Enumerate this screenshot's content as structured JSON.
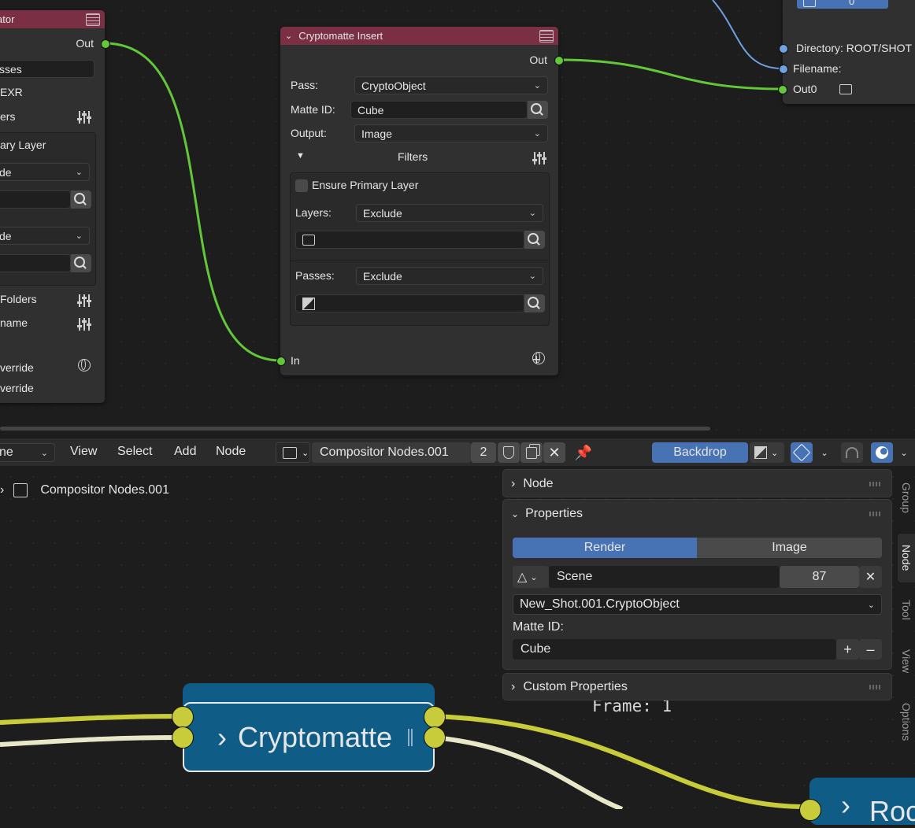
{
  "left_node": {
    "title": "ator",
    "out_label": "Out",
    "field_value": "sses",
    "format": "EXR",
    "rows": [
      "ers",
      "ary Layer",
      "de",
      "de",
      "Folders",
      "name",
      "verride",
      "verride"
    ]
  },
  "crypto_node": {
    "title": "Cryptomatte Insert",
    "out_label": "Out",
    "pass_label": "Pass:",
    "pass_value": "CryptoObject",
    "matte_label": "Matte ID:",
    "matte_value": "Cube",
    "output_label": "Output:",
    "output_value": "Image",
    "filters_label": "Filters",
    "ensure_label": "Ensure Primary Layer",
    "layers_label": "Layers:",
    "layers_value": "Exclude",
    "passes_label": "Passes:",
    "passes_value": "Exclude",
    "in_label": "In"
  },
  "file_node": {
    "directory": "Directory: ROOT/SHOT",
    "filename": "Filename:",
    "out0": "Out0",
    "slot_value": "0"
  },
  "header": {
    "mode": "ne",
    "menus": [
      "View",
      "Select",
      "Add",
      "Node"
    ],
    "node_tree_name": "Compositor Nodes.001",
    "users": "2",
    "backdrop": "Backdrop"
  },
  "breadcrumb": {
    "name": "Compositor Nodes.001"
  },
  "sidebar": {
    "node_panel": "Node",
    "properties_panel": "Properties",
    "tab_render": "Render",
    "tab_image": "Image",
    "scene_name": "Scene",
    "scene_users": "87",
    "layer": "New_Shot.001.CryptoObject",
    "matte_label": "Matte ID:",
    "matte_value": "Cube",
    "custom_panel": "Custom Properties",
    "vtabs": [
      "Group",
      "Node",
      "Tool",
      "View",
      "Options"
    ]
  },
  "backdrop_text": "Frame: 1",
  "group_node": {
    "label": "Cryptomatte"
  },
  "right_group_node": {
    "label": "Roc"
  }
}
